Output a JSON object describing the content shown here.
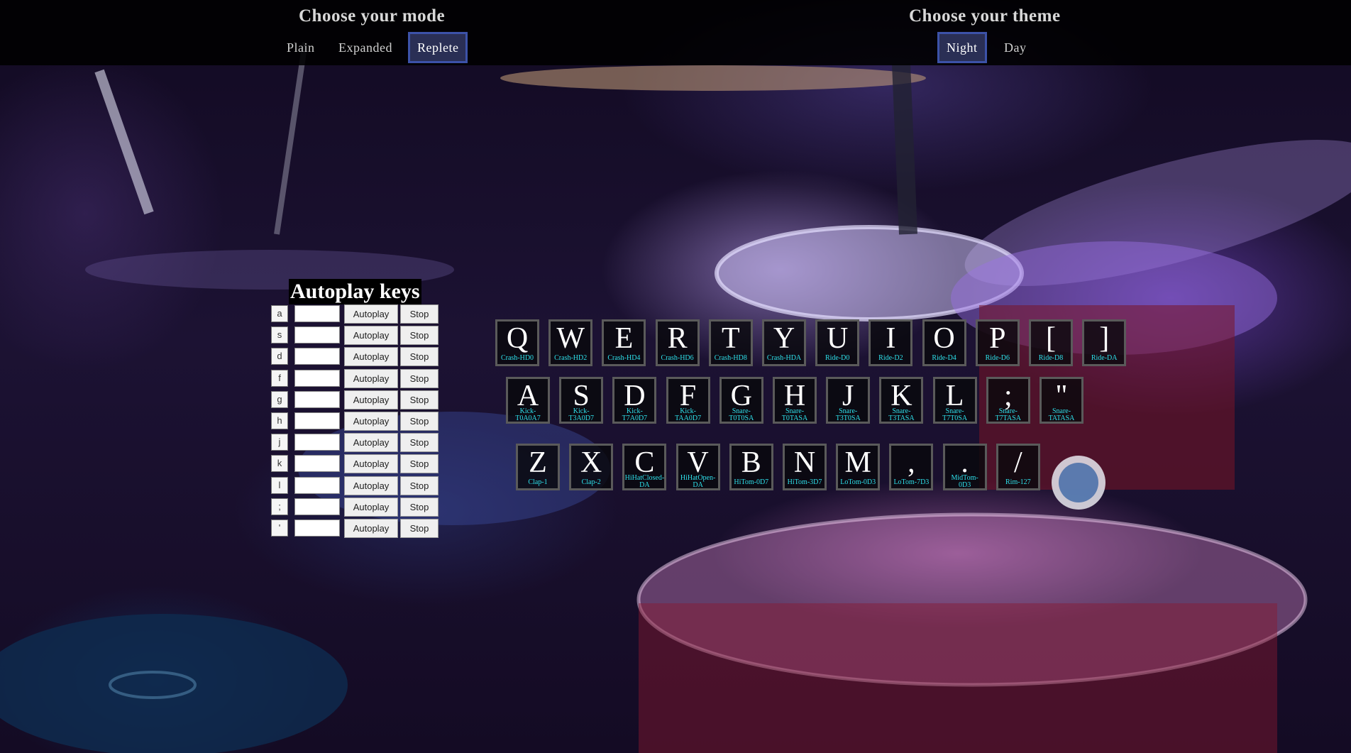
{
  "header": {
    "mode": {
      "title": "Choose your mode",
      "options": [
        "Plain",
        "Expanded",
        "Replete"
      ],
      "selected": "Replete"
    },
    "theme": {
      "title": "Choose your theme",
      "options": [
        "Night",
        "Day"
      ],
      "selected": "Night"
    }
  },
  "autoplay": {
    "title": "Autoplay keys",
    "autoplay_label": "Autoplay",
    "stop_label": "Stop",
    "rows": [
      {
        "key": "a",
        "value": ""
      },
      {
        "key": "s",
        "value": ""
      },
      {
        "key": "d",
        "value": ""
      },
      {
        "key": "f",
        "value": ""
      },
      {
        "key": "g",
        "value": ""
      },
      {
        "key": "h",
        "value": ""
      },
      {
        "key": "j",
        "value": ""
      },
      {
        "key": "k",
        "value": ""
      },
      {
        "key": "l",
        "value": ""
      },
      {
        "key": ";",
        "value": ""
      },
      {
        "key": "'",
        "value": ""
      }
    ]
  },
  "pads": {
    "row1": [
      {
        "key": "Q",
        "sound": "Crash-HD0"
      },
      {
        "key": "W",
        "sound": "Crash-HD2"
      },
      {
        "key": "E",
        "sound": "Crash-HD4"
      },
      {
        "key": "R",
        "sound": "Crash-HD6"
      },
      {
        "key": "T",
        "sound": "Crash-HD8"
      },
      {
        "key": "Y",
        "sound": "Crash-HDA"
      },
      {
        "key": "U",
        "sound": "Ride-D0"
      },
      {
        "key": "I",
        "sound": "Ride-D2"
      },
      {
        "key": "O",
        "sound": "Ride-D4"
      },
      {
        "key": "P",
        "sound": "Ride-D6"
      },
      {
        "key": "[",
        "sound": "Ride-D8"
      },
      {
        "key": "]",
        "sound": "Ride-DA"
      }
    ],
    "row2": [
      {
        "key": "A",
        "sound": "Kick-T0A0A7"
      },
      {
        "key": "S",
        "sound": "Kick-T3A0D7"
      },
      {
        "key": "D",
        "sound": "Kick-T7A0D7"
      },
      {
        "key": "F",
        "sound": "Kick-TAA0D7"
      },
      {
        "key": "G",
        "sound": "Snare-T0T0SA"
      },
      {
        "key": "H",
        "sound": "Snare-T0TASA"
      },
      {
        "key": "J",
        "sound": "Snare-T3T0SA"
      },
      {
        "key": "K",
        "sound": "Snare-T3TASA"
      },
      {
        "key": "L",
        "sound": "Snare-T7T0SA"
      },
      {
        "key": ";",
        "sound": "Snare-T7TASA"
      },
      {
        "key": "\"",
        "sound": "Snare-TATASA"
      }
    ],
    "row3": [
      {
        "key": "Z",
        "sound": "Clap-1"
      },
      {
        "key": "X",
        "sound": "Clap-2"
      },
      {
        "key": "C",
        "sound": "HiHatClosed-DA"
      },
      {
        "key": "V",
        "sound": "HiHatOpen-DA"
      },
      {
        "key": "B",
        "sound": "HiTom-0D7"
      },
      {
        "key": "N",
        "sound": "HiTom-3D7"
      },
      {
        "key": "M",
        "sound": "LoTom-0D3"
      },
      {
        "key": ",",
        "sound": "LoTom-7D3"
      },
      {
        "key": ".",
        "sound": "MidTom-0D3"
      },
      {
        "key": "/",
        "sound": "Rim-127"
      }
    ]
  }
}
